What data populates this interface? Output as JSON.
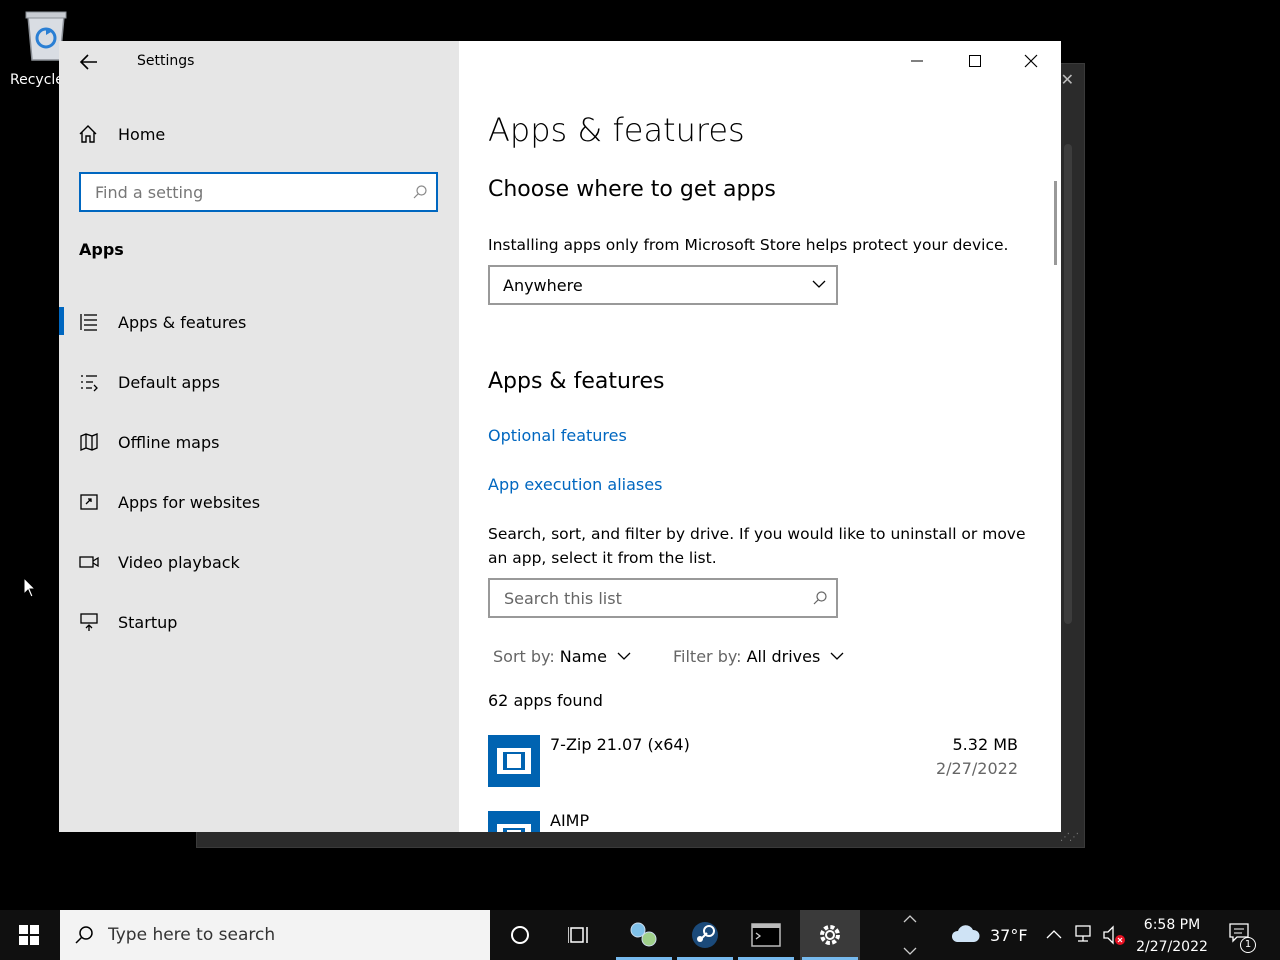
{
  "desktop": {
    "recycle_label": "Recycle"
  },
  "window": {
    "title": "Settings",
    "sidebar": {
      "home_label": "Home",
      "search_placeholder": "Find a setting",
      "section_label": "Apps",
      "items": [
        {
          "label": "Apps & features",
          "icon": "list-icon",
          "active": true
        },
        {
          "label": "Default apps",
          "icon": "default-apps-icon"
        },
        {
          "label": "Offline maps",
          "icon": "map-icon"
        },
        {
          "label": "Apps for websites",
          "icon": "link-app-icon"
        },
        {
          "label": "Video playback",
          "icon": "video-icon"
        },
        {
          "label": "Startup",
          "icon": "startup-icon"
        }
      ]
    },
    "main": {
      "title": "Apps & features",
      "choose_heading": "Choose where to get apps",
      "choose_desc": "Installing apps only from Microsoft Store helps protect your device.",
      "source_selected": "Anywhere",
      "features_heading": "Apps & features",
      "optional_features_link": "Optional features",
      "aliases_link": "App execution aliases",
      "list_desc": "Search, sort, and filter by drive. If you would like to uninstall or move an app, select it from the list.",
      "list_search_placeholder": "Search this list",
      "sort_key": "Sort by:",
      "sort_value": "Name",
      "filter_key": "Filter by:",
      "filter_value": "All drives",
      "apps_found": "62 apps found",
      "apps": [
        {
          "name": "7-Zip 21.07 (x64)",
          "size": "5.32 MB",
          "date": "2/27/2022"
        },
        {
          "name": "AIMP",
          "size": "",
          "date": ""
        }
      ]
    }
  },
  "taskbar": {
    "search_placeholder": "Type here to search",
    "weather": "37°F",
    "time": "6:58 PM",
    "date": "2/27/2022",
    "notification_count": "1"
  },
  "colors": {
    "accent": "#0067c0",
    "sidebar_bg": "#e6e6e6",
    "taskbar_bg": "#101010"
  }
}
